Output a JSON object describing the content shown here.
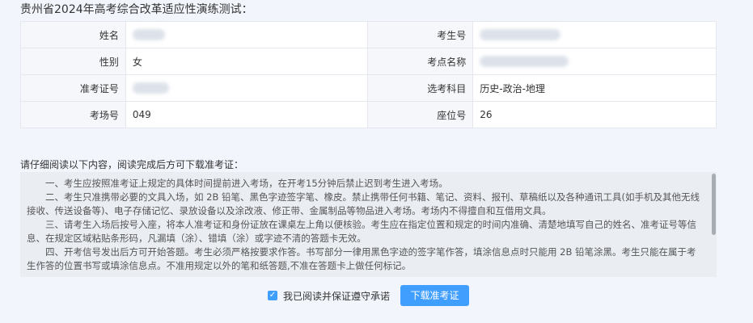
{
  "page_title": "贵州省2024年高考综合改革适应性演练测试：",
  "info_table": {
    "rows": [
      {
        "left_label": "姓名",
        "left_value": "",
        "right_label": "考生号",
        "right_value": ""
      },
      {
        "left_label": "性别",
        "left_value": "女",
        "right_label": "考点名称",
        "right_value": ""
      },
      {
        "left_label": "准考证号",
        "left_value": "",
        "right_label": "选考科目",
        "right_value": "历史-政治-地理"
      },
      {
        "left_label": "考场号",
        "left_value": "049",
        "right_label": "座位号",
        "right_value": "26"
      }
    ]
  },
  "notice": {
    "title": "请仔细阅读以下内容，阅读完成后方可下载准考证：",
    "paragraphs": [
      "一、考生应按照准考证上规定的具体时间提前进入考场，在开考15分钟后禁止迟到考生进入考场。",
      "二、考生只准携带必要的文具入场，如 2B 铅笔、黑色字迹签字笔、橡皮。禁止携带任何书籍、笔记、资料、报刊、草稿纸以及各种通讯工具(如手机及其他无线接收、传送设备等)、电子存储记忆、录放设备以及涂改液、修正带、金属制品等物品进入考场。考场内不得擅自和互借用文具。",
      "三、请考生入场后按号入座，将本人准考证和身份证放在课桌左上角以便核验。考生应在指定位置和规定的时间内准确、清楚地填写自己的姓名、准考证号等信息、在规定区域粘贴条形码，凡漏填（涂）、错填（涂）或字迹不清的答题卡无效。",
      "四、开考信号发出后方可开始答题。考生必须严格按要求作答。书写部分一律用黑色字迹的签字笔作答，填涂信息点时只能用 2B 铅笔涂黑。考生只能在属于考生作答的位置书写或填涂信息点。不准用规定以外的笔和纸答题,不准在答题卡上做任何标记。"
    ]
  },
  "agree": {
    "label": "我已阅读并保证遵守承诺",
    "checked": true
  },
  "download_button": "下载准考证",
  "colors": {
    "accent": "#409eff",
    "label_bg": "#f5f7fa",
    "border": "#e4e7ed"
  }
}
